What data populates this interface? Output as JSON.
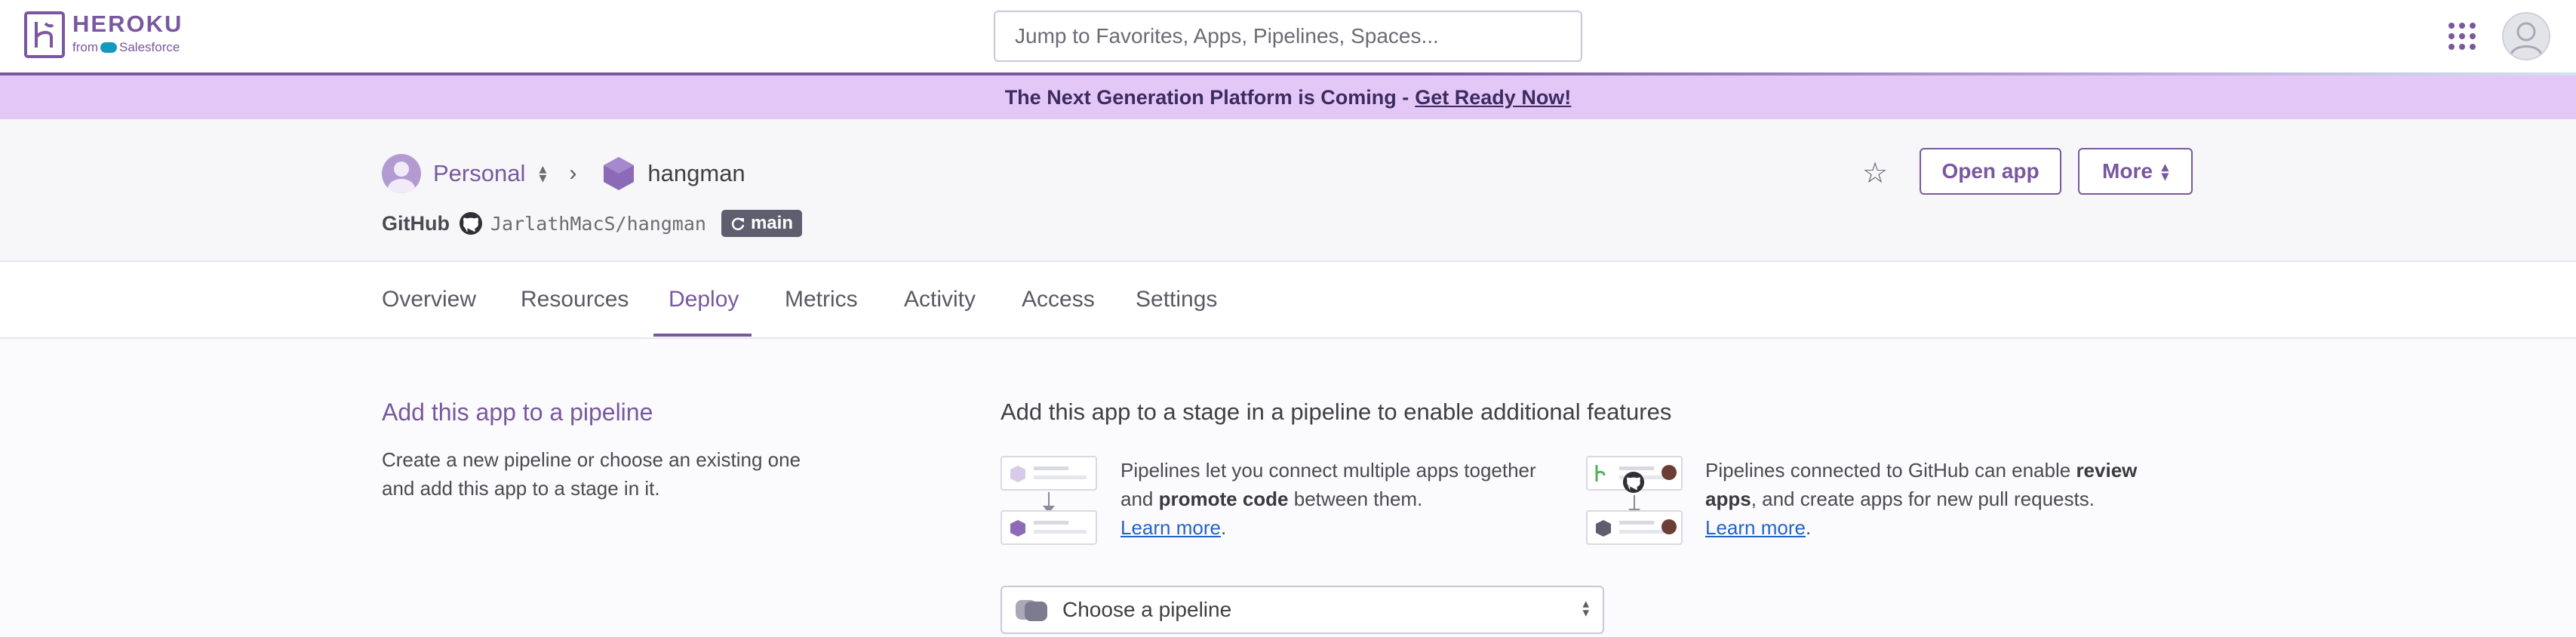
{
  "topnav": {
    "brand": "HEROKU",
    "brand_sub_prefix": "from",
    "brand_sub_name": "Salesforce",
    "search_placeholder": "Jump to Favorites, Apps, Pipelines, Spaces..."
  },
  "banner": {
    "text": "The Next Generation Platform is Coming - ",
    "link": "Get Ready Now!"
  },
  "app_header": {
    "owner": "Personal",
    "app_name": "hangman",
    "source": "GitHub",
    "repo": "JarlathMacS/hangman",
    "branch": "main",
    "open_app_label": "Open app",
    "more_label": "More"
  },
  "tabs": [
    "Overview",
    "Resources",
    "Deploy",
    "Metrics",
    "Activity",
    "Access",
    "Settings"
  ],
  "active_tab": "Deploy",
  "pipeline_section": {
    "title": "Add this app to a pipeline",
    "description": "Create a new pipeline or choose an existing one and add this app to a stage in it.",
    "stage_title": "Add this app to a stage in a pipeline to enable additional features",
    "feature1": {
      "pre": "Pipelines let you connect multiple apps together and ",
      "bold": "promote code",
      "post": " between them.",
      "link": "Learn more"
    },
    "feature2": {
      "pre": "Pipelines connected to GitHub can enable ",
      "bold": "review apps",
      "post": ", and create apps for new pull requests.",
      "link": "Learn more"
    },
    "select_label": "Choose a pipeline"
  },
  "colors": {
    "brand": "#79589f",
    "banner_bg": "#e3c8f7",
    "link": "#2762c7"
  },
  "icons": [
    "heroku-logo-icon",
    "apps-grid-icon",
    "user-avatar-icon",
    "owner-avatar-icon",
    "app-hexagon-icon",
    "github-icon",
    "sync-icon",
    "star-icon",
    "chevron-updown-icon",
    "chevron-right-icon",
    "pipeline-icon"
  ]
}
